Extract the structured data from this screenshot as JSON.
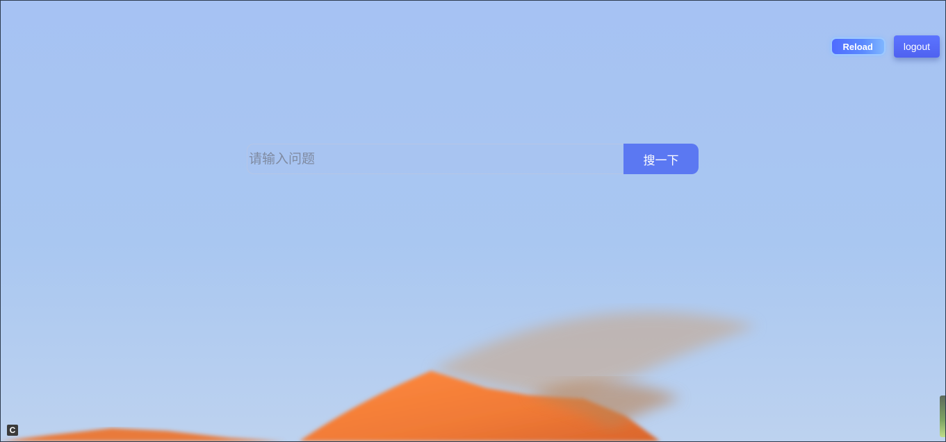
{
  "header": {
    "reload_label": "Reload",
    "logout_label": "logout"
  },
  "search": {
    "placeholder": "请输入问题",
    "value": "",
    "button_label": "搜一下"
  },
  "corner_badge": {
    "letter": "C"
  },
  "icons": {
    "corner_badge": "c-badge-icon",
    "side_meter": "level-meter-icon"
  },
  "colors": {
    "accent": "#5b78f2",
    "sky": "#a7c3f4",
    "dune": "#f07a36"
  }
}
